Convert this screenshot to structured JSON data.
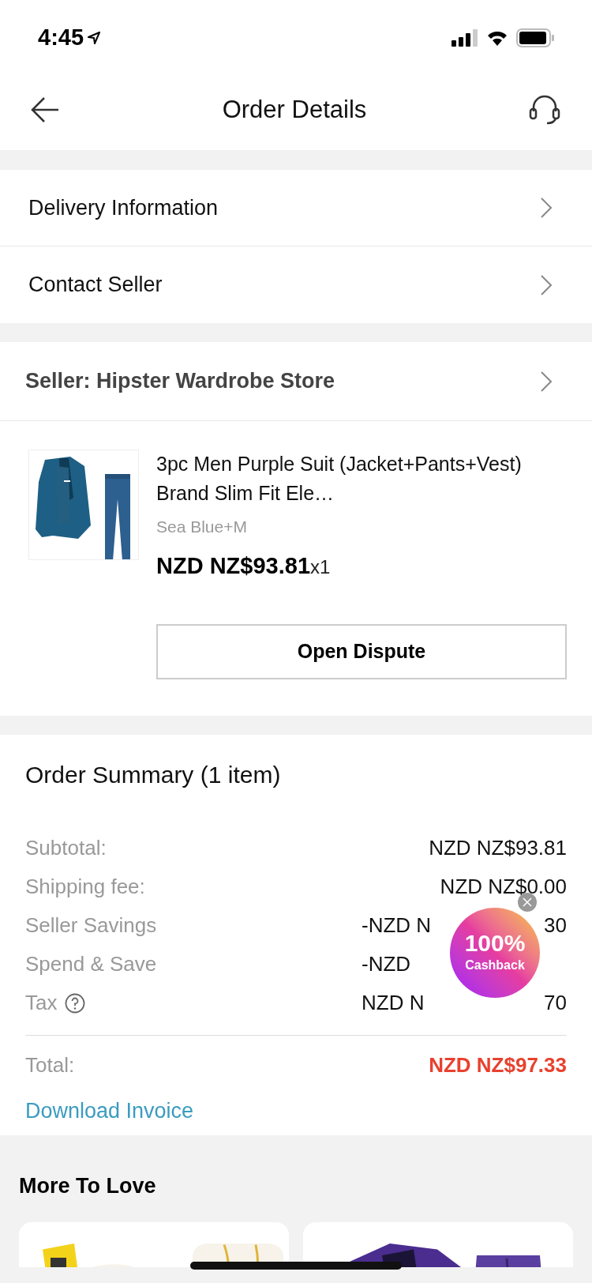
{
  "status_bar": {
    "time": "4:45"
  },
  "header": {
    "title": "Order Details"
  },
  "links": [
    {
      "label": "Delivery Information"
    },
    {
      "label": "Contact Seller"
    }
  ],
  "seller": {
    "label": "Seller: Hipster Wardrobe Store"
  },
  "product": {
    "title": "3pc Men Purple Suit (Jacket+Pants+Vest) Brand Slim Fit Ele…",
    "variant": "Sea Blue+M",
    "price": "NZD NZ$93.81",
    "quantity": "x1",
    "button": "Open Dispute"
  },
  "summary": {
    "title": "Order Summary (1 item)",
    "rows": [
      {
        "label": "Subtotal:",
        "value": "NZD NZ$93.81"
      },
      {
        "label": "Shipping fee:",
        "value": "NZD NZ$0.00"
      },
      {
        "label": "Seller Savings",
        "value": "-NZD N",
        "value_end": "30"
      },
      {
        "label": "Spend & Save",
        "value": "-NZD"
      },
      {
        "label": "Tax",
        "kind": "info",
        "value": "NZD N",
        "value_end": "70"
      }
    ],
    "total_label": "Total:",
    "total_value": "NZD NZ$97.33",
    "invoice_link": "Download Invoice"
  },
  "promo_badge": {
    "line_1": "100%",
    "line_2": "Cashback"
  },
  "more_to_love": {
    "title": "More To Love"
  }
}
